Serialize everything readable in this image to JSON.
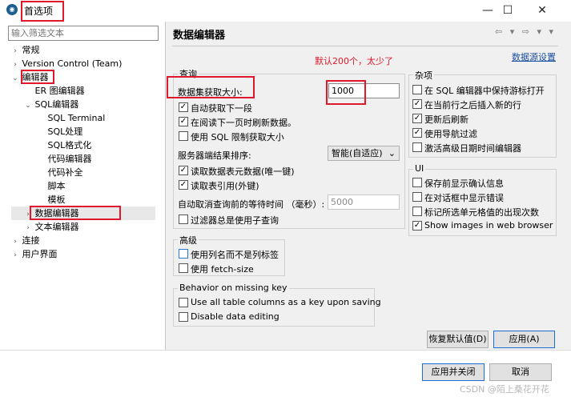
{
  "window": {
    "title": "首选项",
    "minimize": "—",
    "maximize": "☐",
    "close": "✕"
  },
  "filter": {
    "placeholder": "输入筛选文本"
  },
  "tree": [
    {
      "label": "常规",
      "toggle": "›"
    },
    {
      "label": "Version Control (Team)",
      "toggle": "›"
    },
    {
      "label": "编辑器",
      "toggle": "⌄"
    },
    {
      "label": "ER 图编辑器",
      "toggle": ""
    },
    {
      "label": "SQL编辑器",
      "toggle": "⌄"
    },
    {
      "label": "SQL Terminal",
      "toggle": ""
    },
    {
      "label": "SQL处理",
      "toggle": ""
    },
    {
      "label": "SQL格式化",
      "toggle": ""
    },
    {
      "label": "代码编辑器",
      "toggle": ""
    },
    {
      "label": "代码补全",
      "toggle": ""
    },
    {
      "label": "脚本",
      "toggle": ""
    },
    {
      "label": "模板",
      "toggle": ""
    },
    {
      "label": "数据编辑器",
      "toggle": "›"
    },
    {
      "label": "文本编辑器",
      "toggle": "›"
    },
    {
      "label": "连接",
      "toggle": "›"
    },
    {
      "label": "用户界面",
      "toggle": "›"
    }
  ],
  "pane": {
    "title": "数据编辑器",
    "nav": "⇦ ▾ ⇨ ▾ ▾",
    "link": "数据源设置",
    "annotation": "默认200个，太少了"
  },
  "query": {
    "legend": "查询",
    "fetch_size_label": "数据集获取大小:",
    "fetch_size_value": "1000",
    "checks": [
      {
        "label": "自动获取下一段",
        "checked": true
      },
      {
        "label": "在阅读下一页时刷新数据。",
        "checked": true
      },
      {
        "label": "使用 SQL 限制获取大小",
        "checked": false
      }
    ],
    "sort_label": "服务器端结果排序:",
    "sort_value": "智能(自适应)",
    "checks2": [
      {
        "label": "读取数据表元数据(唯一键)",
        "checked": true
      },
      {
        "label": "读取表引用(外键)",
        "checked": true
      }
    ],
    "cancel_wait_label": "自动取消查询前的等待时间 （毫秒）:",
    "cancel_wait_value": "5000",
    "filter_check": {
      "label": "过滤器总是使用子查询",
      "checked": false
    }
  },
  "advanced": {
    "legend": "高级",
    "checks": [
      {
        "label": "使用列名而不是列标签",
        "checked": false
      },
      {
        "label": "使用 fetch-size",
        "checked": false
      }
    ]
  },
  "missing_key": {
    "legend": "Behavior on missing key",
    "checks": [
      {
        "label": "Use all table columns as a key upon saving",
        "checked": false
      },
      {
        "label": "Disable data editing",
        "checked": false
      }
    ]
  },
  "misc": {
    "legend": "杂项",
    "checks": [
      {
        "label": "在 SQL 编辑器中保持游标打开",
        "checked": false
      },
      {
        "label": "在当前行之后插入新的行",
        "checked": true
      },
      {
        "label": "更新后刷新",
        "checked": true
      },
      {
        "label": "使用导航过滤",
        "checked": true
      },
      {
        "label": "激活高级日期时间编辑器",
        "checked": false
      }
    ]
  },
  "ui": {
    "legend": "UI",
    "checks": [
      {
        "label": "保存前显示确认信息",
        "checked": false
      },
      {
        "label": "在对话框中显示错误",
        "checked": false
      },
      {
        "label": "标记所选单元格值的出现次数",
        "checked": false
      },
      {
        "label": "Show images in web browser",
        "checked": true
      }
    ]
  },
  "buttons": {
    "restore": "恢复默认值(D)",
    "apply": "应用(A)",
    "apply_close": "应用并关闭",
    "cancel": "取消"
  },
  "watermark": "CSDN @陌上桑花开花"
}
